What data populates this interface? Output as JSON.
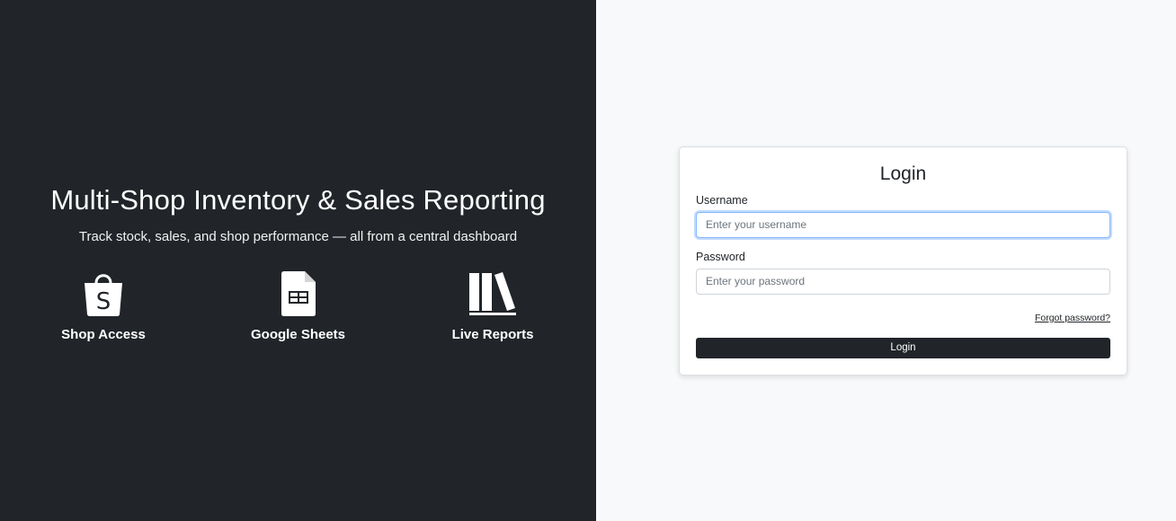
{
  "hero": {
    "title": "Multi-Shop Inventory & Sales Reporting",
    "subtitle": "Track stock, sales, and shop performance — all from a central dashboard",
    "features": [
      {
        "label": "Shop Access",
        "icon": "shopping-bag-icon"
      },
      {
        "label": "Google Sheets",
        "icon": "spreadsheet-icon"
      },
      {
        "label": "Live Reports",
        "icon": "books-icon"
      }
    ]
  },
  "login": {
    "title": "Login",
    "username_label": "Username",
    "username_placeholder": "Enter your username",
    "password_label": "Password",
    "password_placeholder": "Enter your password",
    "forgot_label": "Forgot password?",
    "submit_label": "Login"
  },
  "colors": {
    "dark": "#212529",
    "light_bg": "#f8f9fa",
    "focus": "#86b7fe"
  }
}
